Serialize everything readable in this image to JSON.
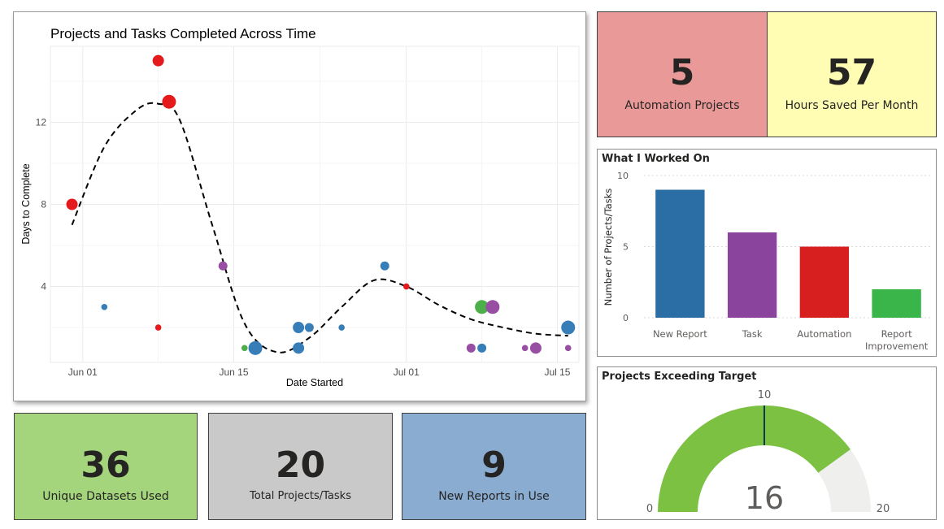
{
  "kpis": {
    "automation_projects": {
      "value": "5",
      "label": "Automation Projects",
      "color": "#ea9999"
    },
    "hours_saved": {
      "value": "57",
      "label": "Hours Saved Per Month",
      "color": "#fefdb3"
    },
    "unique_datasets": {
      "value": "36",
      "label": "Unique Datasets Used",
      "color": "#a4d57c"
    },
    "total_projects": {
      "value": "20",
      "label": "Total Projects/Tasks",
      "color": "#c8c9c8"
    },
    "new_reports": {
      "value": "9",
      "label": "New Reports in Use",
      "color": "#89acd0"
    }
  },
  "chart_data": [
    {
      "type": "scatter",
      "title": "Projects and Tasks Completed Across Time",
      "xlabel": "Date Started",
      "ylabel": "Days to Complete",
      "x_ticks": [
        "Jun 01",
        "Jun 15",
        "Jul 01",
        "Jul 15"
      ],
      "x_tick_dates": [
        "2023-06-01",
        "2023-06-15",
        "2023-07-01",
        "2023-07-15"
      ],
      "y_ticks": [
        4,
        8,
        12
      ],
      "xlim": [
        "2023-05-29",
        "2023-07-17"
      ],
      "ylim": [
        0.3,
        15.7
      ],
      "grid": true,
      "colors": {
        "New Report": "#377eb8",
        "Task": "#984ea3",
        "Automation": "#e41a1c",
        "Report Improvement": "#4daf4a"
      },
      "points": [
        {
          "x": "2023-05-31",
          "y": 8,
          "category": "Automation",
          "size": "large"
        },
        {
          "x": "2023-06-03",
          "y": 3,
          "category": "New Report",
          "size": "small"
        },
        {
          "x": "2023-06-08",
          "y": 15,
          "category": "Automation",
          "size": "large"
        },
        {
          "x": "2023-06-08",
          "y": 2,
          "category": "Automation",
          "size": "small"
        },
        {
          "x": "2023-06-09",
          "y": 13,
          "category": "Automation",
          "size": "xlarge"
        },
        {
          "x": "2023-06-14",
          "y": 5,
          "category": "Task",
          "size": "medium"
        },
        {
          "x": "2023-06-16",
          "y": 1,
          "category": "Report Improvement",
          "size": "small"
        },
        {
          "x": "2023-06-17",
          "y": 1,
          "category": "New Report",
          "size": "xlarge"
        },
        {
          "x": "2023-06-21",
          "y": 2,
          "category": "New Report",
          "size": "large"
        },
        {
          "x": "2023-06-21",
          "y": 1,
          "category": "New Report",
          "size": "large"
        },
        {
          "x": "2023-06-22",
          "y": 2,
          "category": "New Report",
          "size": "medium"
        },
        {
          "x": "2023-06-25",
          "y": 2,
          "category": "New Report",
          "size": "small"
        },
        {
          "x": "2023-06-29",
          "y": 5,
          "category": "New Report",
          "size": "medium"
        },
        {
          "x": "2023-07-01",
          "y": 4,
          "category": "Automation",
          "size": "small"
        },
        {
          "x": "2023-07-07",
          "y": 1,
          "category": "Task",
          "size": "medium"
        },
        {
          "x": "2023-07-08",
          "y": 3,
          "category": "Report Improvement",
          "size": "xlarge"
        },
        {
          "x": "2023-07-08",
          "y": 1,
          "category": "New Report",
          "size": "medium"
        },
        {
          "x": "2023-07-09",
          "y": 3,
          "category": "Task",
          "size": "xlarge"
        },
        {
          "x": "2023-07-12",
          "y": 1,
          "category": "Task",
          "size": "small"
        },
        {
          "x": "2023-07-13",
          "y": 1,
          "category": "Task",
          "size": "large"
        },
        {
          "x": "2023-07-16",
          "y": 1,
          "category": "Task",
          "size": "small"
        },
        {
          "x": "2023-07-16",
          "y": 2,
          "category": "New Report",
          "size": "xlarge"
        }
      ],
      "trend_line": {
        "style": "dashed",
        "x": [
          "2023-05-31",
          "2023-06-03",
          "2023-06-06",
          "2023-06-08",
          "2023-06-10",
          "2023-06-13",
          "2023-06-16",
          "2023-06-19",
          "2023-06-22",
          "2023-06-25",
          "2023-06-28",
          "2023-07-01",
          "2023-07-04",
          "2023-07-07",
          "2023-07-10",
          "2023-07-13",
          "2023-07-16"
        ],
        "y": [
          7.0,
          10.8,
          12.6,
          12.9,
          12.1,
          7.0,
          2.2,
          0.8,
          1.5,
          3.0,
          4.3,
          4.0,
          3.1,
          2.4,
          2.0,
          1.7,
          1.6
        ]
      }
    },
    {
      "type": "bar",
      "title": "What I Worked On",
      "ylabel": "Number of Projects/Tasks",
      "categories": [
        "New Report",
        "Task",
        "Automation",
        "Report Improvement"
      ],
      "category_label_lines": [
        [
          "New Report"
        ],
        [
          "Task"
        ],
        [
          "Automation"
        ],
        [
          "Report",
          "Improvement"
        ]
      ],
      "values": [
        9,
        6,
        5,
        2
      ],
      "colors": [
        "#2a6ea5",
        "#8a449e",
        "#d71f1f",
        "#3ab54a"
      ],
      "y_ticks": [
        0,
        5,
        10
      ],
      "ylim": [
        0,
        10
      ],
      "grid": true
    },
    {
      "type": "gauge",
      "title": "Projects Exceeding Target",
      "value": 16,
      "min": 0,
      "max": 20,
      "target": 10,
      "value_label": "16",
      "min_label": "0",
      "max_label": "20",
      "target_label": "10",
      "fill_color": "#7cc142",
      "track_color": "#efefed",
      "target_color": "#0b3c4a"
    }
  ]
}
